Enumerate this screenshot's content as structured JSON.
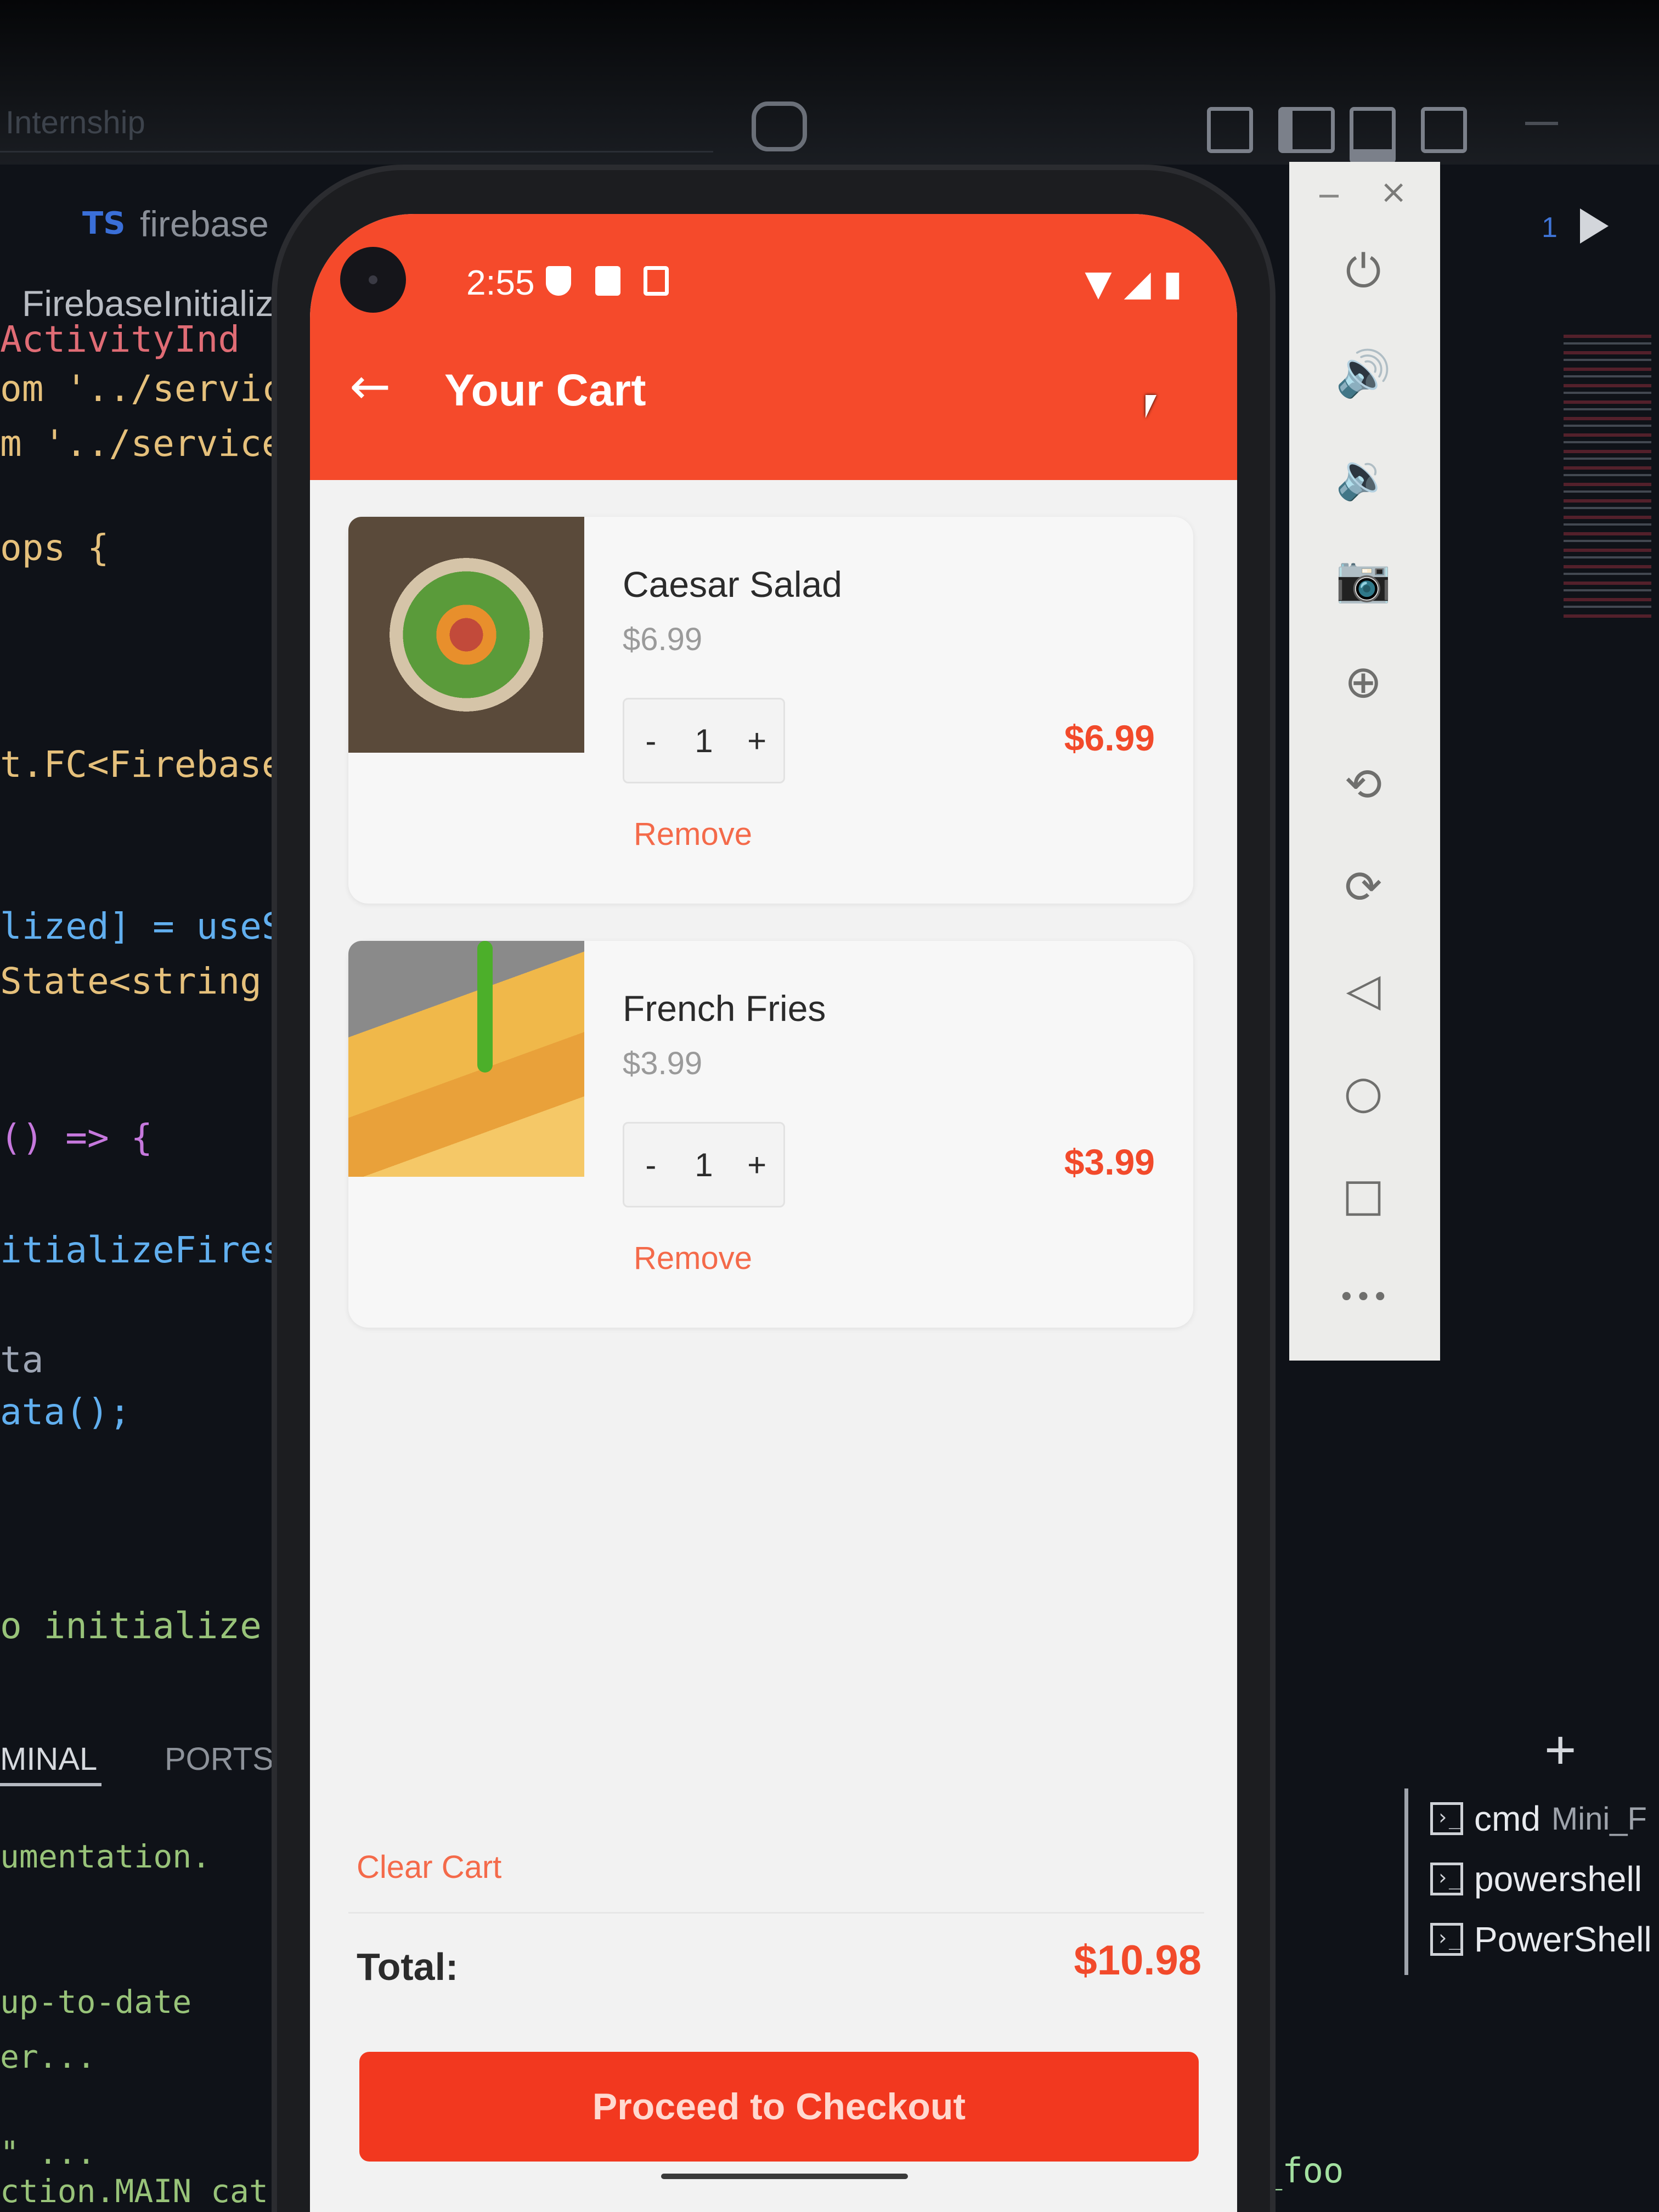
{
  "ide": {
    "window_title": "Internship",
    "tab_badge": "TS",
    "tab_name": "firebase",
    "breadcrumb": "FirebaseInitializ",
    "code_lines": [
      {
        "text": "ActivityInd",
        "color": "#e06c75"
      },
      {
        "text": "om '../servic",
        "color": "#e5c07b"
      },
      {
        "text": "m '../service",
        "color": "#e5c07b"
      },
      {
        "text": "ops {",
        "color": "#e5c07b"
      },
      {
        "text": "t.FC<Firebase",
        "color": "#e5c07b"
      },
      {
        "text": "lized] = useS",
        "color": "#61afef"
      },
      {
        "text": "State<string",
        "color": "#e5c07b"
      },
      {
        "text": "() => {",
        "color": "#c678dd"
      },
      {
        "text": "itializeFires",
        "color": "#61afef"
      },
      {
        "text": "ta",
        "color": "#9da5b4"
      },
      {
        "text": "ata();",
        "color": "#61afef"
      },
      {
        "text": "o initialize",
        "color": "#98c379"
      }
    ],
    "terminal_tabs": [
      "MINAL",
      "PORTS"
    ],
    "terminal_lines": [
      "umentation.",
      "up-to-date",
      "er...",
      "\" ...",
      "ction.MAIN cat"
    ],
    "terminal_sessions": [
      {
        "name": "cmd",
        "detail": "Mini_F"
      },
      {
        "name": "powershell",
        "detail": ""
      },
      {
        "name": "PowerShell",
        "detail": ""
      }
    ],
    "right_run_number": "1",
    "bottom_right_text": "_foo",
    "file_tab_partial": "fi"
  },
  "emulator_toolbar": {
    "items": [
      {
        "name": "power-icon",
        "glyph": "⏻"
      },
      {
        "name": "volume-up-icon",
        "glyph": "🔊"
      },
      {
        "name": "volume-down-icon",
        "glyph": "🔉"
      },
      {
        "name": "camera-icon",
        "glyph": "📷"
      },
      {
        "name": "zoom-in-icon",
        "glyph": "⊕"
      },
      {
        "name": "rotate-left-icon",
        "glyph": "⟲"
      },
      {
        "name": "rotate-right-icon",
        "glyph": "⟳"
      },
      {
        "name": "back-nav-icon",
        "glyph": "◁"
      },
      {
        "name": "home-nav-icon",
        "glyph": "○"
      },
      {
        "name": "overview-nav-icon",
        "glyph": "□"
      },
      {
        "name": "more-icon",
        "glyph": "•••"
      }
    ]
  },
  "status_bar": {
    "time": "2:55"
  },
  "app_bar": {
    "title": "Your Cart"
  },
  "cart": {
    "items": [
      {
        "name": "Caesar Salad",
        "unit_price": "$6.99",
        "quantity": "1",
        "line_total": "$6.99",
        "remove_label": "Remove"
      },
      {
        "name": "French Fries",
        "unit_price": "$3.99",
        "quantity": "1",
        "line_total": "$3.99",
        "remove_label": "Remove"
      }
    ],
    "decrement_label": "-",
    "increment_label": "+",
    "clear_label": "Clear Cart",
    "total_label": "Total:",
    "total_value": "$10.98",
    "checkout_label": "Proceed to Checkout"
  },
  "colors": {
    "accent": "#f54a2b",
    "price": "#f24a2b",
    "link": "#f46a4a"
  }
}
